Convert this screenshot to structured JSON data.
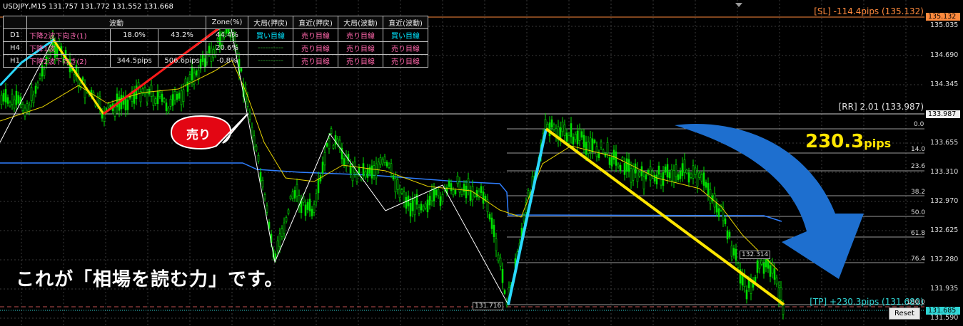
{
  "header": {
    "symbol_info": "USDJPY,M15  131.757 131.772 131.552 131.668"
  },
  "table": {
    "headers": [
      "",
      "波動",
      "",
      "",
      "Zone(%)",
      "大局(押戻)",
      "直近(押戻)",
      "大局(波動)",
      "直近(波動)"
    ],
    "rows": [
      {
        "tf": "D1",
        "wave": "下降2波下向き(1)",
        "v1": "18.0%",
        "v2": "43.2%",
        "zone": "44.4%",
        "a": "買い目線",
        "b": "売り目線",
        "c": "売り目線",
        "d": "買い目線"
      },
      {
        "tf": "H4",
        "wave": "下降1波",
        "v1": "",
        "v2": "",
        "zone": "20.6%",
        "a": "----------",
        "b": "売り目線",
        "c": "売り目線",
        "d": "売り目線"
      },
      {
        "tf": "H1",
        "wave": "下降2波下向き(2)",
        "v1": "344.5pips",
        "v2": "506.6pips",
        "zone": "-0.8%",
        "a": "----------",
        "b": "売り目線",
        "c": "売り目線",
        "d": "売り目線"
      }
    ]
  },
  "labels": {
    "sl": "[SL] -114.4pips (135.132)",
    "rr": "[RR] 2.01  (133.987)",
    "tp": "[TP] +230.3pips  (131.680)",
    "pips_big": "230.3",
    "pips_unit": "pips",
    "sell_bubble": "売り",
    "caption": "これが「相場を読む力」です。",
    "low_box": "131.716",
    "mid_box": "132.314",
    "reset": "Reset"
  },
  "price_axis": [
    "135.035",
    "134.690",
    "134.345",
    "133.655",
    "133.310",
    "132.970",
    "132.625",
    "132.280",
    "131.935",
    "131.590"
  ],
  "price_tags": {
    "sl": "135.132",
    "rr": "133.987",
    "tp": "131.685",
    "tp_hidden": "131.76?"
  },
  "fib_levels": [
    "0.0",
    "14.0",
    "23.6",
    "38.2",
    "50.0",
    "61.8",
    "76.4",
    "100.0"
  ],
  "colors": {
    "candle": "#00e000",
    "blue_ma": "#2f7fff",
    "yellow_ma": "#e6d200",
    "zigzag": "#ffffff",
    "arrow": "#1e6fcf",
    "sl": "#ff8a3d",
    "tp": "#2fd6d6"
  }
}
